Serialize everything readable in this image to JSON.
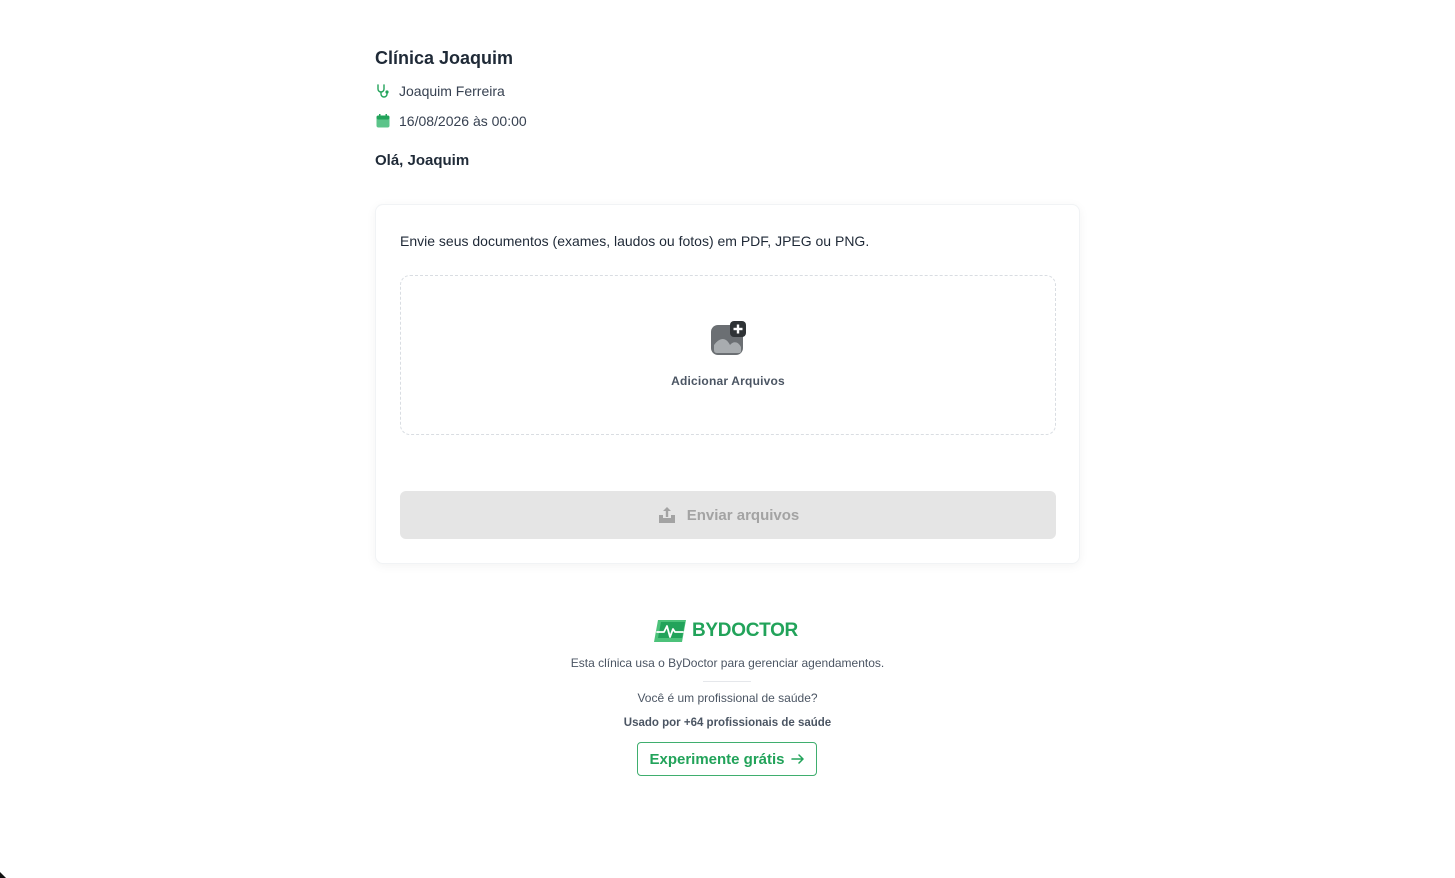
{
  "clinic": {
    "name": "Clínica Joaquim",
    "doctor": "Joaquim Ferreira",
    "datetime": "16/08/2026 às 00:00",
    "greeting": "Olá, Joaquim"
  },
  "upload": {
    "description": "Envie seus documentos (exames, laudos ou fotos) em PDF, JPEG ou PNG.",
    "add_files_label": "Adicionar Arquivos",
    "send_label": "Enviar arquivos"
  },
  "footer": {
    "brand": "BYDOCTOR",
    "uses_text": "Esta clínica usa o ByDoctor para gerenciar agendamentos.",
    "question": "Você é um profissional de saúde?",
    "used_by": "Usado por +64 profissionais de saúde",
    "cta_label": "Experimente grátis"
  },
  "colors": {
    "brand_green": "#22a35a",
    "disabled_button": "#e5e5e5"
  },
  "icons": {
    "doctor": "stethoscope-icon",
    "date": "calendar-icon",
    "add_files": "image-add-icon",
    "send": "upload-icon",
    "cta": "arrow-right-icon"
  }
}
